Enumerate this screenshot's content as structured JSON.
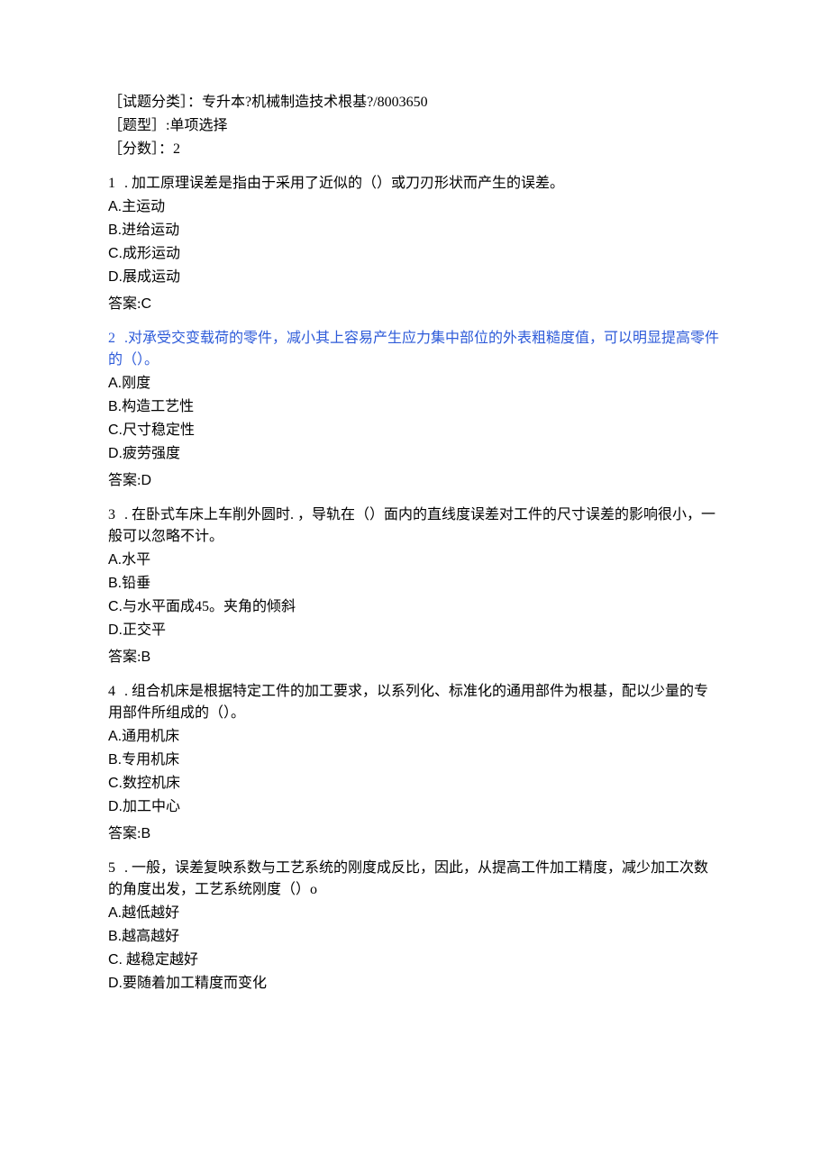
{
  "meta": {
    "category_line": "［试题分类］：专升本?机械制造技术根基?/8003650",
    "type_line": "［题型］:单项选择",
    "score_line": "［分数］：2"
  },
  "questions": [
    {
      "num": "1",
      "stem": " . 加工原理误差是指由于采用了近似的（）或刀刃形状而产生的误差。",
      "stem_blue": false,
      "options": [
        {
          "letter": "A.",
          "text": "主运动"
        },
        {
          "letter": "B.",
          "text": "进给运动"
        },
        {
          "letter": "C.",
          "text": "成形运动"
        },
        {
          "letter": "D.",
          "text": "展成运动"
        }
      ],
      "answer_label": "答案:",
      "answer_value": "C"
    },
    {
      "num": "2",
      "stem": " .对承受交变载荷的零件，减小其上容易产生应力集中部位的外表粗糙度值，可以明显提高零件的（）。",
      "stem_blue": true,
      "options": [
        {
          "letter": "A.",
          "text": "刚度"
        },
        {
          "letter": "B.",
          "text": "构造工艺性"
        },
        {
          "letter": "C.",
          "text": "尺寸稳定性"
        },
        {
          "letter": "D.",
          "text": "疲劳强度"
        }
      ],
      "answer_label": "答案:",
      "answer_value": "D"
    },
    {
      "num": "3",
      "stem": " . 在卧式车床上车削外圆时. ，导轨在（）面内的直线度误差对工件的尺寸误差的影响很小，一般可以忽略不计。",
      "stem_blue": false,
      "options": [
        {
          "letter": "A.",
          "text": "水平"
        },
        {
          "letter": "B.",
          "text": "铅垂"
        },
        {
          "letter": "C.",
          "text": "与水平面成45。夹角的倾斜"
        },
        {
          "letter": "D.",
          "text": "正交平"
        }
      ],
      "answer_label": "答案:",
      "answer_value": "B"
    },
    {
      "num": "4",
      "stem": " . 组合机床是根据特定工件的加工要求，以系列化、标准化的通用部件为根基，配以少量的专用部件所组成的（）。",
      "stem_blue": false,
      "options": [
        {
          "letter": "A.",
          "text": "通用机床"
        },
        {
          "letter": "B.",
          "text": "专用机床"
        },
        {
          "letter": "C.",
          "text": "数控机床"
        },
        {
          "letter": "D.",
          "text": "加工中心"
        }
      ],
      "answer_label": "答案:",
      "answer_value": "B"
    },
    {
      "num": "5",
      "stem": " . 一般，误差复映系数与工艺系统的刚度成反比，因此，从提高工件加工精度，减少加工次数的角度出发，工艺系统刚度（）o",
      "stem_blue": false,
      "options": [
        {
          "letter": "A.",
          "text": "越低越好"
        },
        {
          "letter": "B.",
          "text": "越高越好"
        },
        {
          "letter": "C.",
          "text": " 越稳定越好"
        },
        {
          "letter": "D.",
          "text": "要随着加工精度而变化"
        }
      ],
      "answer_label": "",
      "answer_value": ""
    }
  ]
}
